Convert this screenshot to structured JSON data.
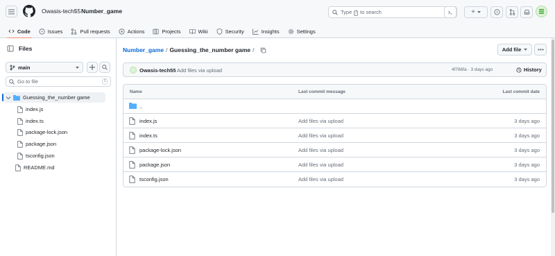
{
  "header": {
    "owner": "Owasis-tech55",
    "separator": "/",
    "repo": "Number_game",
    "search": {
      "prefix": "Type",
      "key": "/",
      "suffix": "to search"
    },
    "plus_label": "+"
  },
  "repo_nav": [
    {
      "label": "Code",
      "icon": "code-icon",
      "active": true
    },
    {
      "label": "Issues",
      "icon": "issue-icon"
    },
    {
      "label": "Pull requests",
      "icon": "pull-request-icon"
    },
    {
      "label": "Actions",
      "icon": "play-icon"
    },
    {
      "label": "Projects",
      "icon": "table-icon"
    },
    {
      "label": "Wiki",
      "icon": "book-icon"
    },
    {
      "label": "Security",
      "icon": "shield-icon"
    },
    {
      "label": "Insights",
      "icon": "graph-icon"
    },
    {
      "label": "Settings",
      "icon": "gear-icon"
    }
  ],
  "tree": {
    "title": "Files",
    "branch": "main",
    "go_to_file": "Go to file",
    "go_to_file_key": "t",
    "folder": "Guessing_the_number game",
    "folder_files": [
      "index.js",
      "index.ts",
      "package-lock.json",
      "package.json",
      "tsconfig.json"
    ],
    "root_files": [
      "README.md"
    ]
  },
  "main": {
    "path_repo": "Number_game",
    "path_sep1": "/",
    "path_folder": "Guessing_the_number game",
    "path_sep2": "/",
    "add_file": "Add file",
    "commit": {
      "author": "Owasis-tech55",
      "message": "Add files via upload",
      "meta": "4f766fa · 3 days ago",
      "history": "History"
    },
    "table": {
      "col_name": "Name",
      "col_message": "Last commit message",
      "col_date": "Last commit date",
      "parent": "..",
      "rows": [
        {
          "name": "index.js",
          "message": "Add files via upload",
          "date": "3 days ago"
        },
        {
          "name": "index.ts",
          "message": "Add files via upload",
          "date": "3 days ago"
        },
        {
          "name": "package-lock.json",
          "message": "Add files via upload",
          "date": "3 days ago"
        },
        {
          "name": "package.json",
          "message": "Add files via upload",
          "date": "3 days ago"
        },
        {
          "name": "tsconfig.json",
          "message": "Add files via upload",
          "date": "3 days ago"
        }
      ]
    }
  },
  "colors": {
    "link": "#0969da",
    "active_tab_underline": "#fd8c73",
    "border": "#d0d7de",
    "muted": "#656d76"
  }
}
